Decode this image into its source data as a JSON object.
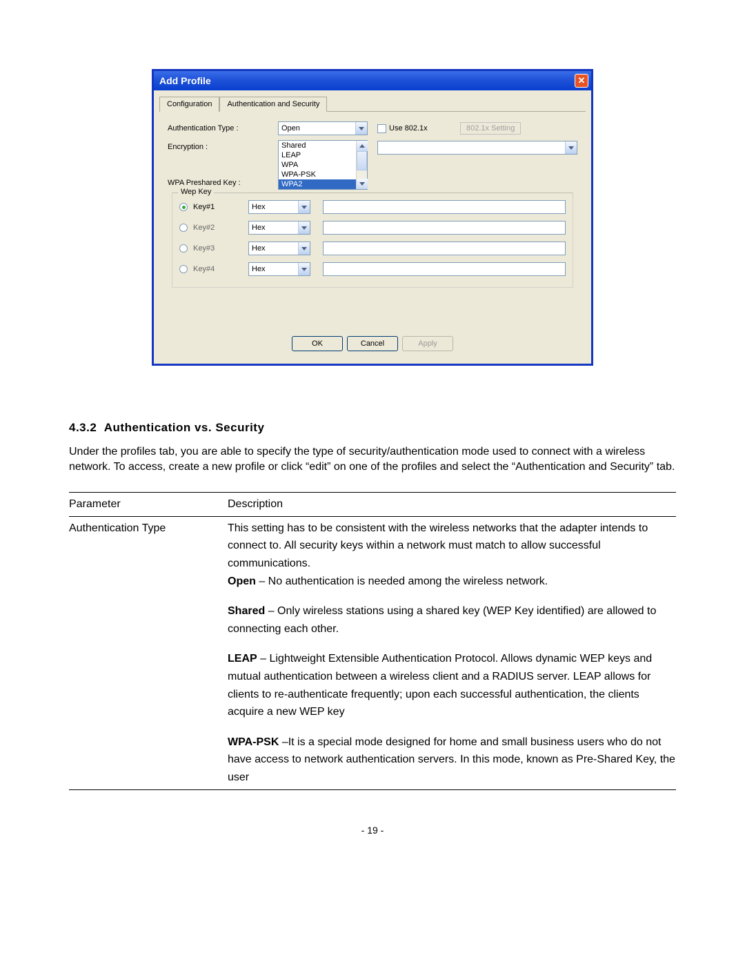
{
  "dialog": {
    "title": "Add Profile",
    "tabs": {
      "configuration": "Configuration",
      "auth": "Authentication and Security"
    },
    "labels": {
      "auth_type": "Authentication Type :",
      "encryption": "Encryption :",
      "wpa_psk": "WPA Preshared Key :",
      "use8021x": "Use 802.1x",
      "btn_8021x": "802.1x Setting",
      "wep": "Wep Key"
    },
    "auth_selected": "Open",
    "auth_options": [
      "Shared",
      "LEAP",
      "WPA",
      "WPA-PSK",
      "WPA2"
    ],
    "wep_keys": [
      {
        "label": "Key#1",
        "format": "Hex",
        "selected": true
      },
      {
        "label": "Key#2",
        "format": "Hex",
        "selected": false
      },
      {
        "label": "Key#3",
        "format": "Hex",
        "selected": false
      },
      {
        "label": "Key#4",
        "format": "Hex",
        "selected": false
      }
    ],
    "buttons": {
      "ok": "OK",
      "cancel": "Cancel",
      "apply": "Apply"
    }
  },
  "doc": {
    "heading_num": "4.3.2",
    "heading_text": "Authentication vs. Security",
    "intro": "Under the profiles tab, you are able to specify the type of security/authentication mode used to connect with a wireless network.   To access, create a new profile or click “edit” on one of the profiles and select the “Authentication and Security” tab.",
    "table": {
      "header_param": "Parameter",
      "header_desc": "Description",
      "row_param": "Authentication Type",
      "desc_intro": "This setting has to be consistent with the wireless networks that the adapter intends to connect to.   All security keys within a network must match to allow successful communications.",
      "open_bold": "Open",
      "open_text": " – No authentication is needed among the wireless network.",
      "shared_bold": "Shared",
      "shared_text": " – Only wireless stations using a shared key (WEP Key identified) are allowed to connecting each other.",
      "leap_bold": "LEAP",
      "leap_text": " – Lightweight Extensible Authentication Protocol.   Allows dynamic WEP keys and mutual authentication between a wireless client and a RADIUS server. LEAP allows for clients to re-authenticate frequently; upon each successful authentication, the clients acquire a new WEP key",
      "wpapsk_bold": "WPA-PSK",
      "wpapsk_text": " –It is a special mode designed for home and small business users who do not have access to network authentication servers. In this mode, known as Pre-Shared Key, the user"
    },
    "page_number": "- 19 -"
  }
}
